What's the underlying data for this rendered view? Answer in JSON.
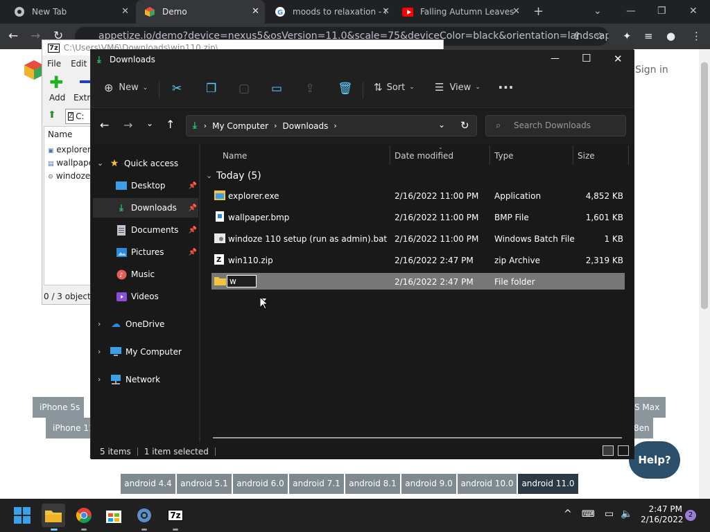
{
  "browser": {
    "tabs": [
      {
        "label": "New Tab",
        "icon": "chrome-icon"
      },
      {
        "label": "Demo",
        "icon": "appetize-icon"
      },
      {
        "label": "moods to relaxation - G",
        "icon": "google-icon"
      },
      {
        "label": "Falling Autumn Leaves",
        "icon": "youtube-icon"
      }
    ],
    "address": "appetize.io/demo?device=nexus5&osVersion=11.0&scale=75&deviceColor=black&orientation=landscape"
  },
  "web_page": {
    "sign_in": "Sign in",
    "devices_row1": [
      "iPhone 5s",
      "S Max"
    ],
    "devices_row2": [
      "iPhone 11",
      "8en"
    ],
    "android_versions": [
      "android 4.4",
      "android 5.1",
      "android 6.0",
      "android 7.1",
      "android 8.1",
      "android 9.0",
      "android 10.0",
      "android 11.0"
    ],
    "help": "Help?"
  },
  "zip": {
    "title": "C:\\Users\\VM6\\Downloads\\win110.zip\\",
    "menu": [
      "File",
      "Edit"
    ],
    "toolbar": [
      "Add",
      "Extra"
    ],
    "path": "C:",
    "column": "Name",
    "files": [
      "explorer.",
      "wallpape",
      "windoze"
    ],
    "status": "0 / 3 object(s"
  },
  "explorer": {
    "title": "Downloads",
    "new_label": "New",
    "sort_label": "Sort",
    "view_label": "View",
    "breadcrumb": [
      "My Computer",
      "Downloads"
    ],
    "search_placeholder": "Search Downloads",
    "sidebar": {
      "quick_access": "Quick access",
      "items": [
        "Desktop",
        "Downloads",
        "Documents",
        "Pictures",
        "Music",
        "Videos"
      ],
      "onedrive": "OneDrive",
      "my_computer": "My Computer",
      "network": "Network"
    },
    "columns": {
      "name": "Name",
      "date": "Date modified",
      "type": "Type",
      "size": "Size"
    },
    "group": "Today (5)",
    "files": [
      {
        "name": "explorer.exe",
        "date": "2/16/2022 11:00 PM",
        "type": "Application",
        "size": "4,852 KB"
      },
      {
        "name": "wallpaper.bmp",
        "date": "2/16/2022 11:00 PM",
        "type": "BMP File",
        "size": "1,601 KB"
      },
      {
        "name": "windoze 110 setup (run as admin).bat",
        "date": "2/16/2022 11:00 PM",
        "type": "Windows Batch File",
        "size": "1 KB"
      },
      {
        "name": "win110.zip",
        "date": "2/16/2022 2:47 PM",
        "type": "zip Archive",
        "size": "2,319 KB"
      },
      {
        "name": "w",
        "date": "2/16/2022 2:47 PM",
        "type": "File folder",
        "size": ""
      }
    ],
    "status_items": "5 items",
    "status_selected": "1 item selected"
  },
  "taskbar": {
    "time": "2:47 PM",
    "date": "2/16/2022",
    "notifications": "2"
  },
  "colors": {
    "accent": "#60cdff",
    "folder": "#f5c342",
    "android_active": "#2b3a44"
  }
}
